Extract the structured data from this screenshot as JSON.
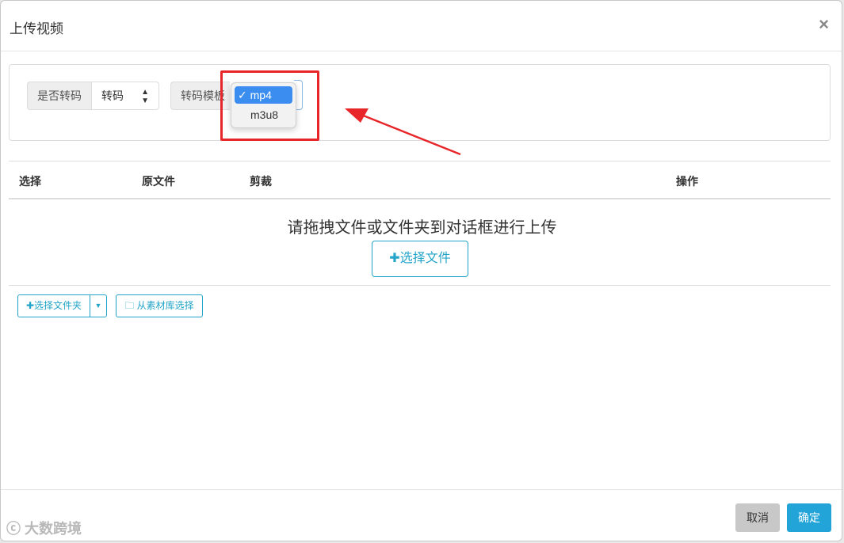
{
  "dialog": {
    "title": "上传视频",
    "close_icon": "×"
  },
  "options": {
    "transcode_label": "是否转码",
    "transcode_value": "转码",
    "template_label": "转码模板",
    "template_options": [
      "mp4",
      "m3u8"
    ],
    "template_selected": "mp4",
    "checkmark": "✓"
  },
  "table": {
    "headers": [
      "选择",
      "原文件",
      "剪裁",
      "操作"
    ]
  },
  "dropzone": {
    "text": "请拖拽文件或文件夹到对话框进行上传",
    "choose_file_label": "选择文件"
  },
  "actions": {
    "choose_folder_label": "选择文件夹",
    "library_label": "从素材库选择"
  },
  "footer": {
    "cancel_label": "取消",
    "confirm_label": "确定"
  },
  "watermark": {
    "text": "大数跨境"
  },
  "colors": {
    "accent": "#23a4c8",
    "annotation": "#e8262a",
    "selected": "#3b8ef0"
  }
}
